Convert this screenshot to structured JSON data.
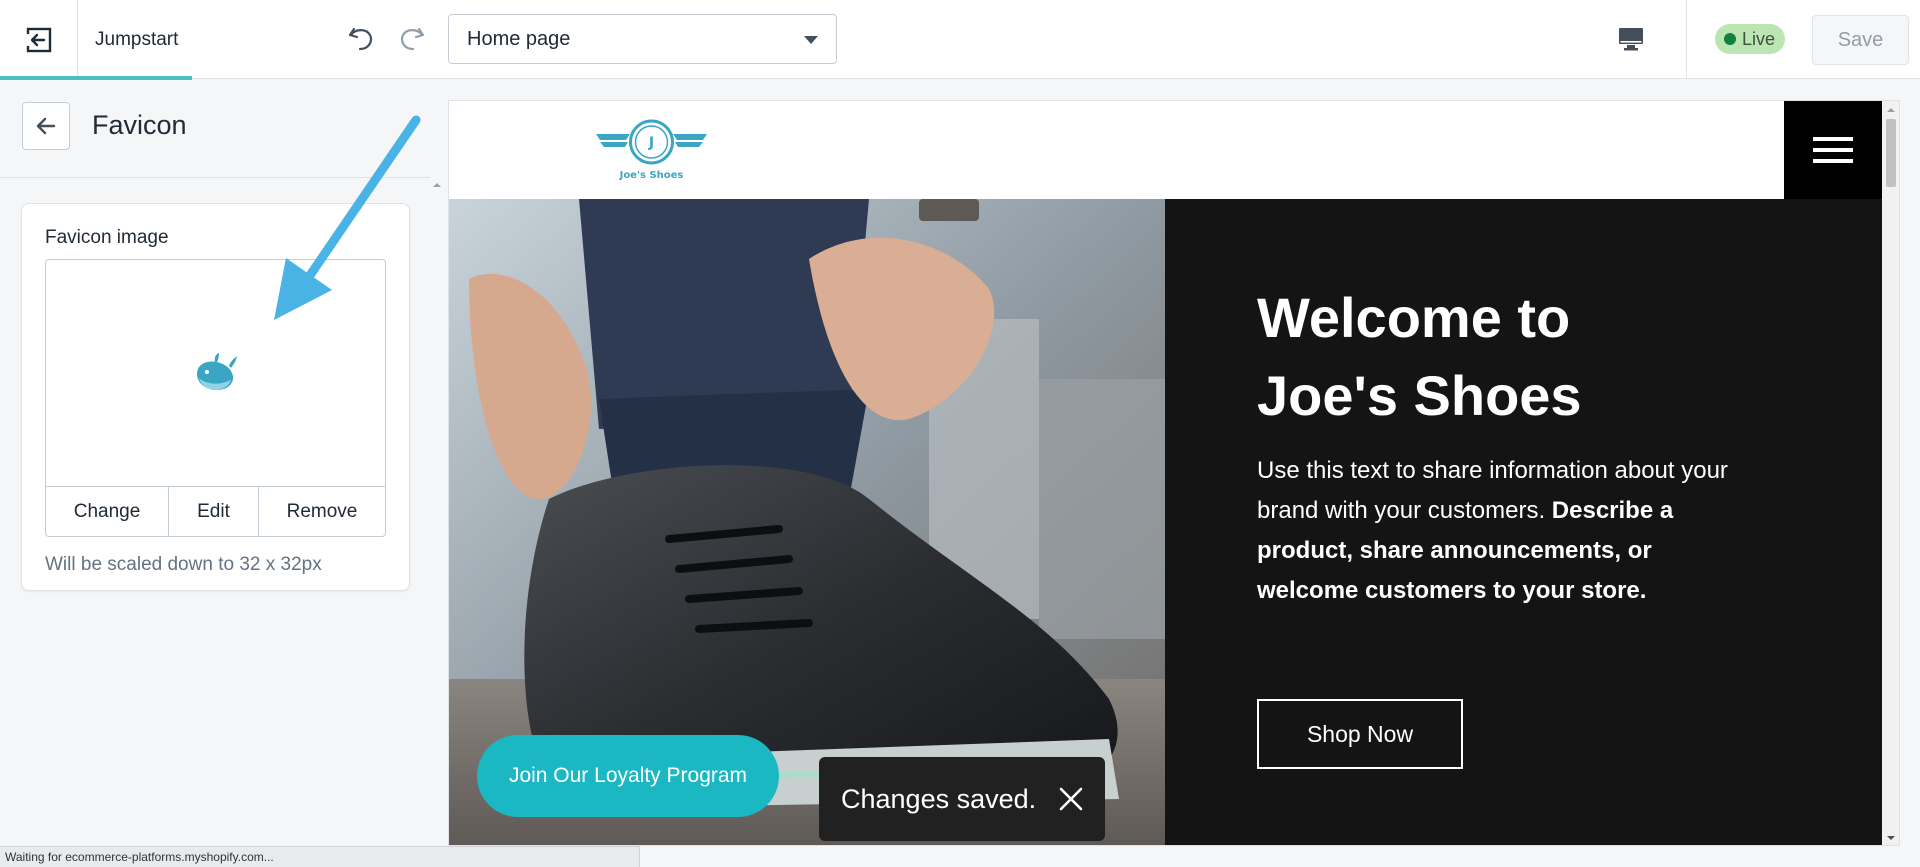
{
  "topbar": {
    "theme_name": "Jumpstart",
    "page_select_value": "Home page",
    "live_label": "Live",
    "save_label": "Save"
  },
  "sidebar": {
    "title": "Favicon",
    "card": {
      "label": "Favicon image",
      "actions": [
        "Change",
        "Edit",
        "Remove"
      ],
      "help_text": "Will be scaled down to 32 x 32px"
    }
  },
  "preview": {
    "logo_letter": "J",
    "logo_text": "Joe's Shoes",
    "hero_title_line1": "Welcome to",
    "hero_title_line2": "Joe's Shoes",
    "hero_text_plain": "Use this text to share information about your brand with your customers.",
    "hero_text_bold": "Describe a product, share announcements, or welcome customers to your store.",
    "shop_button": "Shop Now",
    "loyalty_button": "Join Our Loyalty Program",
    "toast_text": "Changes saved."
  },
  "status_bar": {
    "text": "Waiting for ecommerce-platforms.myshopify.com..."
  },
  "colors": {
    "accent": "#47c1bf",
    "loyalty": "#1bb8c4",
    "live_badge": "#bbe5b3",
    "hero_dark": "#141414",
    "arrow": "#4ab3e6"
  },
  "icons": [
    "exit-icon",
    "undo-icon",
    "redo-icon",
    "chevron-down-icon",
    "desktop-icon",
    "back-arrow-icon",
    "whale-favicon-icon",
    "hamburger-menu-icon",
    "close-icon"
  ]
}
